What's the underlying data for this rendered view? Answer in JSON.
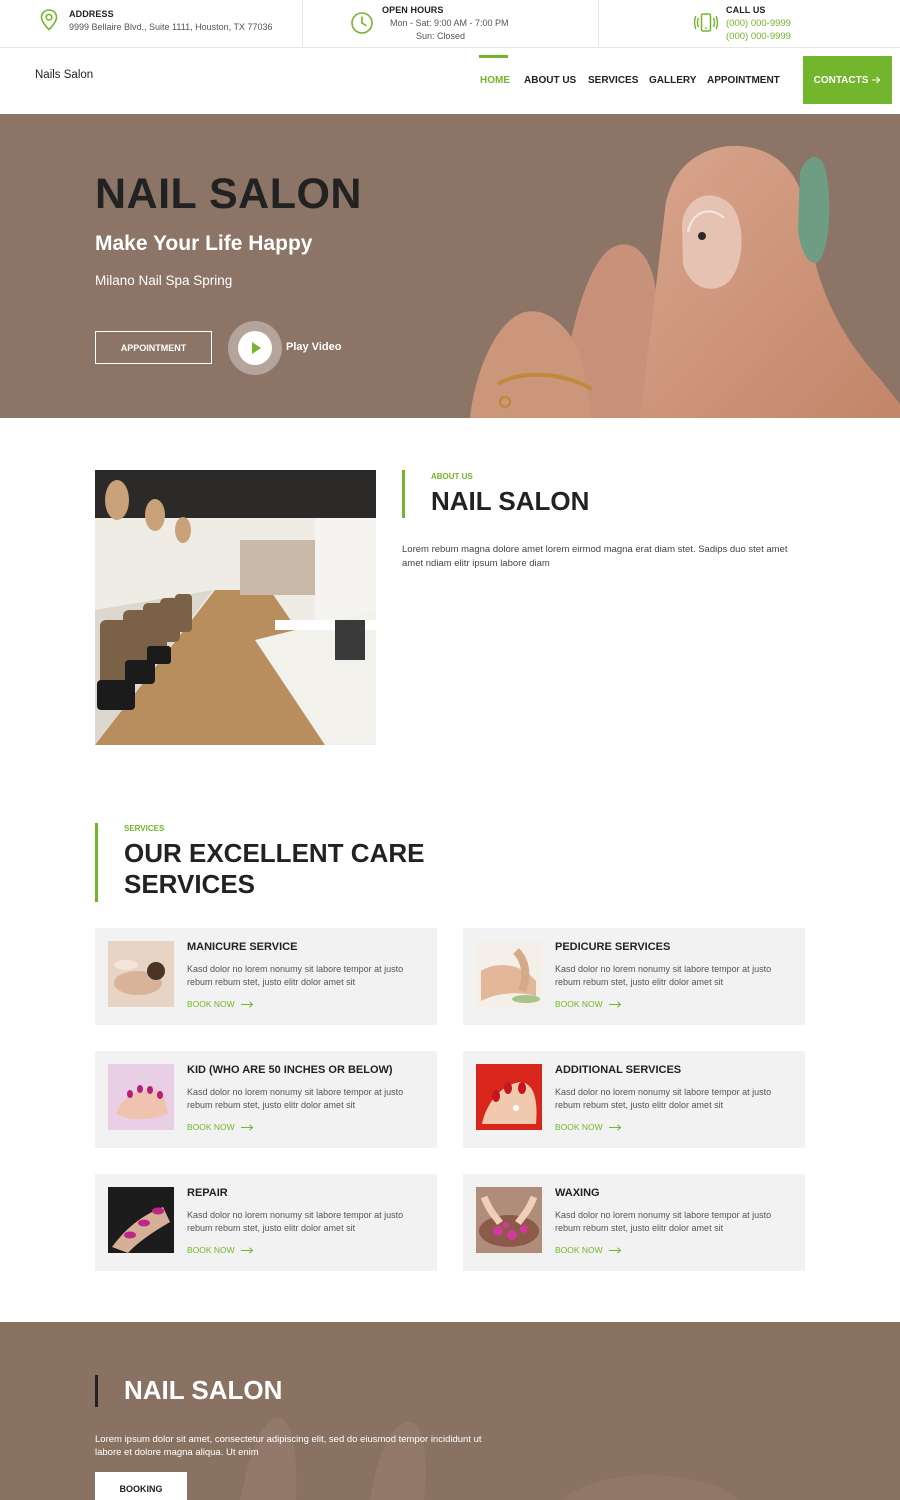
{
  "topbar": {
    "address": {
      "title": "ADDRESS",
      "text": "9999 Bellaire Blvd., Suite 1111, Houston, TX 77036",
      "icon": "map-pin-icon"
    },
    "hours": {
      "title": "OPEN HOURS",
      "line1": "Mon - Sat:  9:00 AM - 7:00 PM",
      "line2": "Sun:  Closed",
      "icon": "clock-icon"
    },
    "call": {
      "title": "CALL US",
      "phone1": "(000) 000-9999",
      "phone2": "(000) 000-9999",
      "icon": "phone-icon"
    }
  },
  "nav": {
    "logo": "Nails Salon",
    "items": [
      {
        "label": "HOME",
        "active": true
      },
      {
        "label": "ABOUT US"
      },
      {
        "label": "SERVICES"
      },
      {
        "label": "GALLERY"
      },
      {
        "label": "APPOINTMENT"
      }
    ],
    "contacts_label": "CONTACTS"
  },
  "hero": {
    "title": "NAIL SALON",
    "subtitle": "Make Your Life Happy",
    "tagline": "Milano Nail Spa Spring",
    "appointment_label": "APPOINTMENT",
    "play_label": "Play Video"
  },
  "about": {
    "kicker": "ABOUT US",
    "title": "NAIL SALON",
    "text": "Lorem rebum magna dolore amet lorem eirmod magna erat diam stet. Sadips duo stet amet amet ndiam elitr ipsum labore diam"
  },
  "services": {
    "kicker": "SERVICES",
    "title_line1": "OUR EXCELLENT CARE",
    "title_line2": "SERVICES",
    "book_label": "BOOK NOW",
    "items": [
      {
        "title": "MANICURE SERVICE",
        "desc": "Kasd dolor no lorem nonumy sit labore tempor at justo rebum rebum stet, justo elitr dolor amet sit"
      },
      {
        "title": "PEDICURE SERVICES",
        "desc": "Kasd dolor no lorem nonumy sit labore tempor at justo rebum rebum stet, justo elitr dolor amet sit"
      },
      {
        "title": "KID (WHO ARE 50 INCHES OR BELOW)",
        "desc": "Kasd dolor no lorem nonumy sit labore tempor at justo rebum rebum stet, justo elitr dolor amet sit"
      },
      {
        "title": "ADDITIONAL SERVICES",
        "desc": "Kasd dolor no lorem nonumy sit labore tempor at justo rebum rebum stet, justo elitr dolor amet sit"
      },
      {
        "title": "REPAIR",
        "desc": "Kasd dolor no lorem nonumy sit labore tempor at justo rebum rebum stet, justo elitr dolor amet sit"
      },
      {
        "title": "WAXING",
        "desc": "Kasd dolor no lorem nonumy sit labore tempor at justo rebum rebum stet, justo elitr dolor amet sit"
      }
    ]
  },
  "band": {
    "title": "NAIL SALON",
    "text": "Lorem ipsum dolor sit amet, consectetur adipiscing elit, sed do eiusmod tempor incididunt ut labore et dolore magna aliqua. Ut enim",
    "booking_label": "BOOKING"
  },
  "colors": {
    "accent": "#73b52c",
    "hero_bg": "#8c7466",
    "card_bg": "#f2f2f2",
    "text_dark": "#222222"
  }
}
